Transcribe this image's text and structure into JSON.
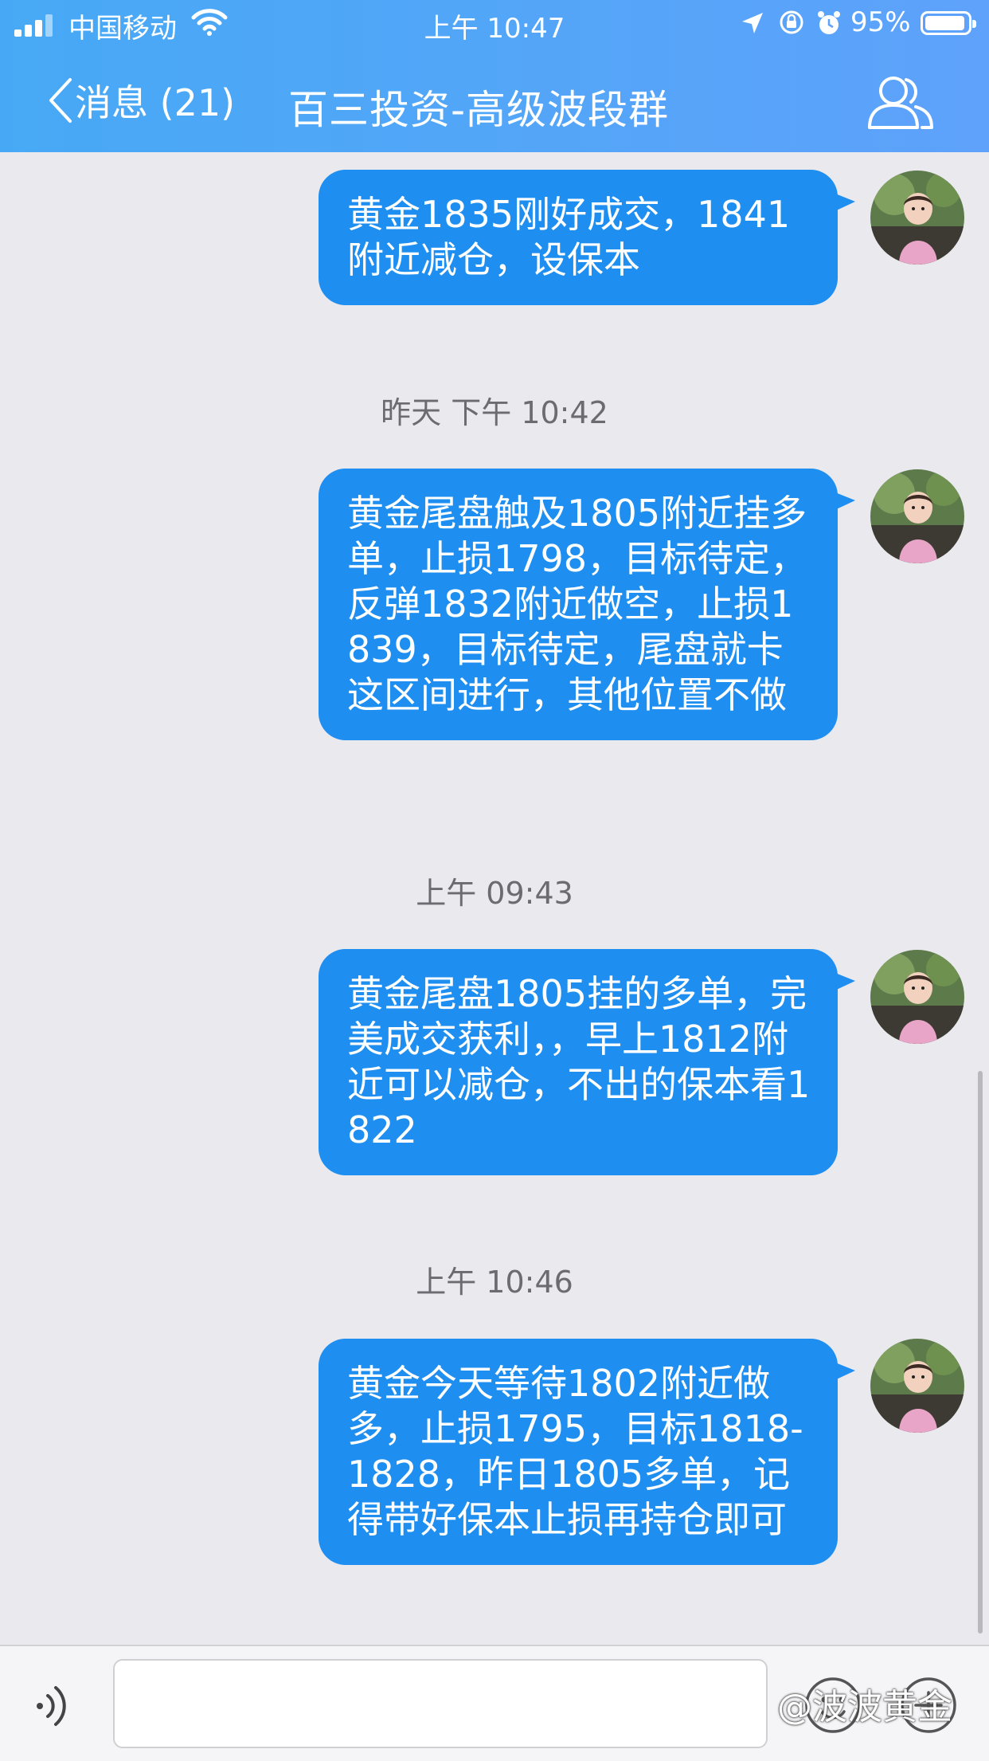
{
  "status_bar": {
    "carrier": "中国移动",
    "time": "上午 10:47",
    "battery_pct": "95%",
    "battery_level": 0.95
  },
  "nav": {
    "back_label": "消息 (21)",
    "title": "百三投资-高级波段群",
    "right_icon": "group-members-icon"
  },
  "messages": [
    {
      "type": "message",
      "text": "黄金1835刚好成交，1841附近减仓，设保本"
    },
    {
      "type": "timestamp",
      "text": "昨天 下午 10:42"
    },
    {
      "type": "message",
      "text": "黄金尾盘触及1805附近挂多单，止损1798，目标待定，反弹1832附近做空，止损1839，目标待定，尾盘就卡这区间进行，其他位置不做"
    },
    {
      "type": "timestamp",
      "text": "上午 09:43"
    },
    {
      "type": "message",
      "text": "黄金尾盘1805挂的多单，完美成交获利，，早上1812附近可以减仓，不出的保本看1822"
    },
    {
      "type": "timestamp",
      "text": "上午 10:46"
    },
    {
      "type": "message",
      "text": "黄金今天等待1802附近做多，止损1795，目标1818-1828，昨日1805多单，记得带好保本止损再持仓即可"
    }
  ],
  "input_bar": {
    "placeholder": "",
    "icons": [
      "voice-icon",
      "emoji-icon",
      "plus-icon"
    ],
    "watermark": "@波波黄金"
  },
  "colors": {
    "header": "#4aa8f6",
    "bubble": "#1e8ef0",
    "background": "#e9e9ee"
  }
}
